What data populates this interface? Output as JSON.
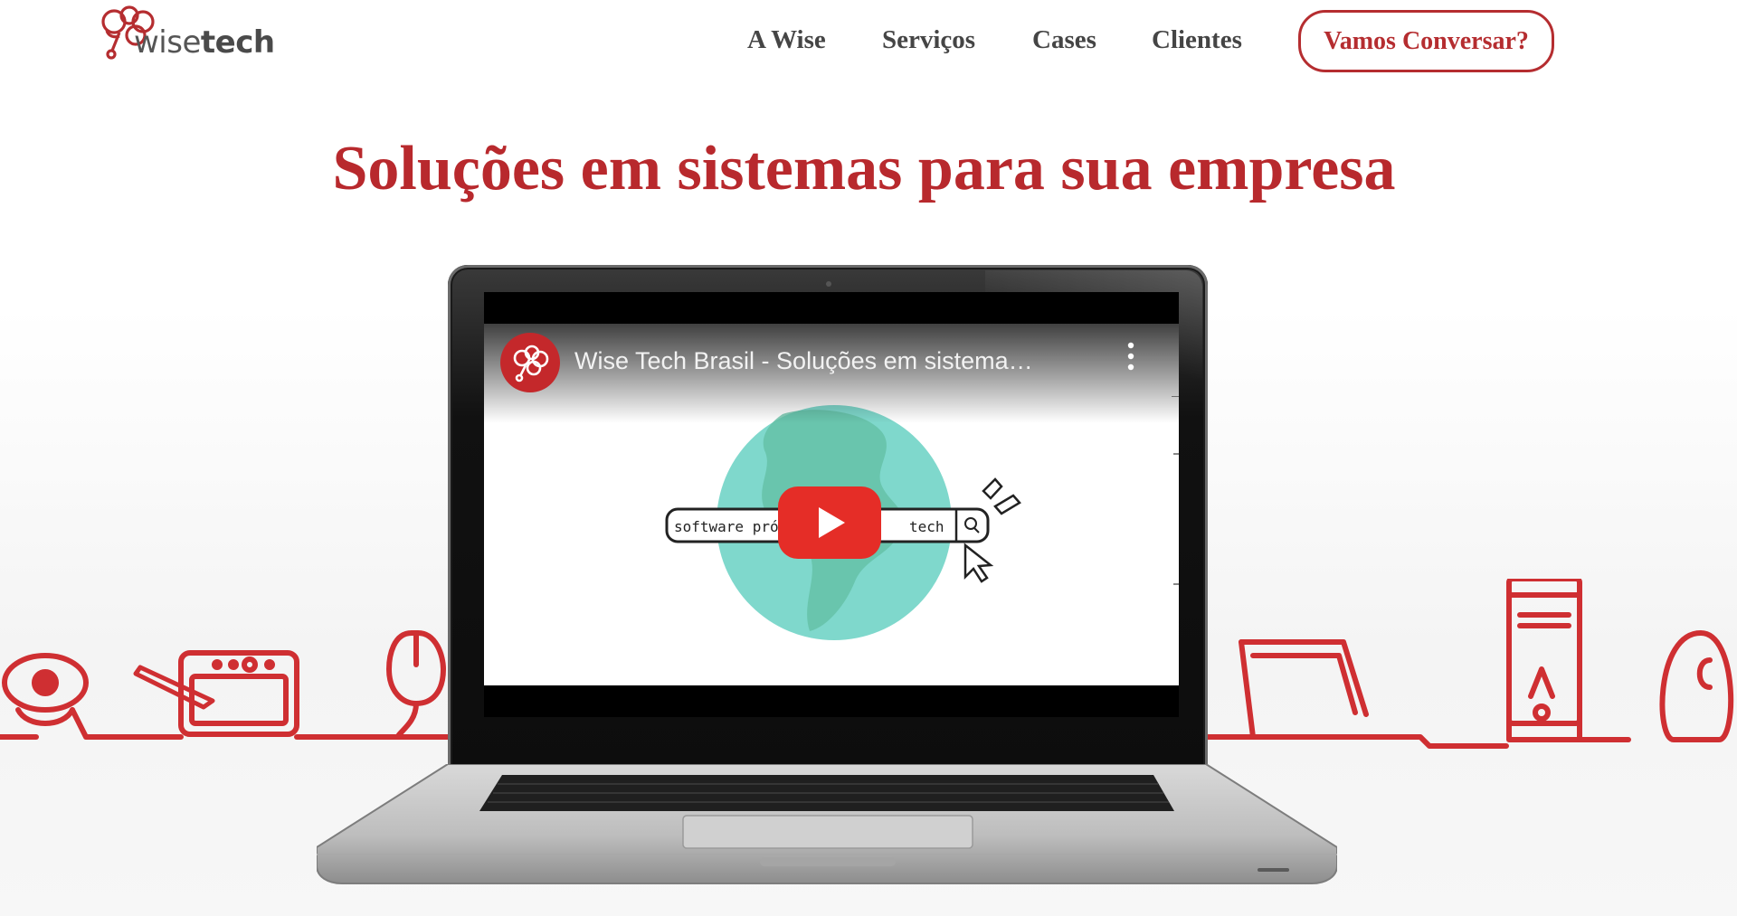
{
  "header": {
    "logo": {
      "text_light": "wise",
      "text_bold": "tech"
    },
    "nav": [
      {
        "label": "A Wise"
      },
      {
        "label": "Serviços"
      },
      {
        "label": "Cases"
      },
      {
        "label": "Clientes"
      }
    ],
    "cta_label": "Vamos Conversar?"
  },
  "hero": {
    "title": "Soluções em sistemas para sua empresa"
  },
  "video": {
    "title": "Wise Tech Brasil - Soluções em sistema…",
    "search_text_left": "software próp",
    "search_text_right": "tech",
    "icons": {
      "channel": "brain-logo-icon",
      "menu": "more-vert-icon",
      "play": "youtube-play-icon",
      "search": "search-icon",
      "cursor": "cursor-icon"
    }
  },
  "colors": {
    "brand_red": "#b8292d",
    "nav_text": "#454545",
    "youtube_red": "#e52d27",
    "globe_teal": "#7fd8cc"
  }
}
